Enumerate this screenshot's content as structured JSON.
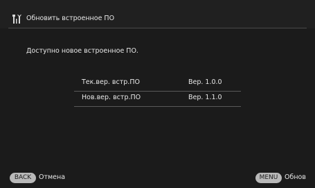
{
  "header": {
    "title": "Обновить встроенное ПО",
    "icon": "tools-icon"
  },
  "message": "Доступно новое встроенное ПО.",
  "versions": [
    {
      "label": "Тек.вер. встр.ПО",
      "value": "Вер. 1.0.0"
    },
    {
      "label": "Нов.вер. встр.ПО",
      "value": "Вер. 1.1.0"
    }
  ],
  "footer": {
    "back_key": "BACK",
    "back_label": "Отмена",
    "menu_key": "MENU",
    "menu_label": "Обнов"
  }
}
